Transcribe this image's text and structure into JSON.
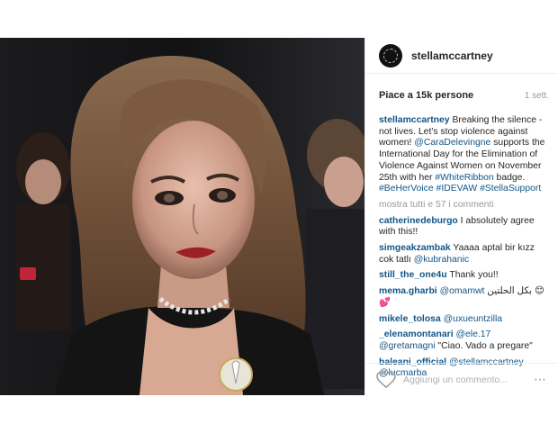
{
  "post": {
    "username": "stellamccartney",
    "likes": "Piace a 15k persone",
    "time": "1 sett.",
    "caption": {
      "user": "stellamccartney",
      "text1": " Breaking the silence - not lives. Let's stop violence against women! ",
      "mention1": "@CaraDelevingne",
      "text2": " supports the International Day for the Elimination of Violence Against Women on November 25th with her ",
      "tag1": "#WhiteRibbon",
      "text3": " badge. ",
      "tag2": "#BeHerVoice",
      "text4": " ",
      "tag3": "#IDEVAW",
      "text5": " ",
      "tag4": "#StellaSupport"
    },
    "more_comments": "mostra tutti e 57 i commenti",
    "comments": [
      {
        "user": "catherinedeburgo",
        "text": " I absolutely agree with this!!"
      },
      {
        "user": "simgeakzambak",
        "text": " Yaaaa aptal bir kızz cok tatlı ",
        "mention": "@kubrahanic"
      },
      {
        "user": "still_the_one4u",
        "text": " Thank you!!"
      },
      {
        "user": "mema.gharbi",
        "text": " ",
        "mention": "@omamwt",
        "tail": " بكل الحلتين 😊💕"
      },
      {
        "user": "mikele_tolosa",
        "text": " ",
        "mention": "@uxueuntzilla"
      },
      {
        "user": "_elenamontanari",
        "text": " ",
        "mention": "@ele.17",
        "text_b": " ",
        "mention_b": "@gretamagni",
        "tail": " \"Ciao. Vado a pregare\""
      },
      {
        "user": "baleani_official",
        "text": " ",
        "mention": "@stellamccartney",
        "text_b": " ",
        "mention_b": "@lucmarba"
      }
    ],
    "add_comment_placeholder": "Aggiungi un commento...",
    "more_icon": "⋯"
  },
  "icons": {
    "avatar": "stella-logo-icon",
    "like": "heart-outline-icon",
    "options": "ellipsis-icon"
  }
}
